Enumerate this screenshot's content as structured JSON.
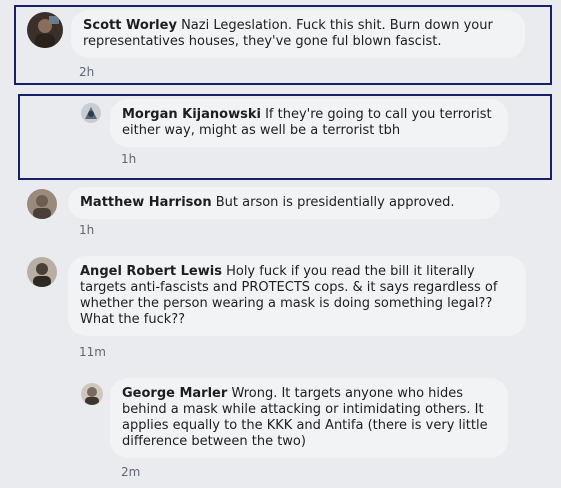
{
  "comments": [
    {
      "author": "Scott Worley",
      "text": "Nazi Legeslation. Fuck this shit. Burn down your representatives houses, they've gone ful blown fascist.",
      "time": "2h",
      "avatar_color": "#3b2f2a",
      "highlighted": true
    },
    {
      "author": "Morgan Kijanowski",
      "text": "If they're going to call you terrorist either way, might as well be a terrorist tbh",
      "time": "1h",
      "avatar_color": "#5a6a7a",
      "highlighted": true
    },
    {
      "author": "Matthew Harrison",
      "text": "But arson is presidentially approved.",
      "time": "1h",
      "avatar_color": "#6b5d52",
      "highlighted": false
    },
    {
      "author": "Angel Robert Lewis",
      "text": "Holy fuck if you read the bill it literally targets anti-fascists and PROTECTS cops. & it says regardless of whether the person wearing a mask is doing something legal?? What the fuck??",
      "time": "11m",
      "avatar_color": "#4a4038",
      "highlighted": false
    },
    {
      "author": "George Marler",
      "text": "Wrong. It targets anyone who hides behind a mask while attacking or intimidating others. It applies equally to the KKK and Antifa (there is very little difference between the two)",
      "time": "2m",
      "avatar_color": "#7a6a5e",
      "highlighted": false
    }
  ],
  "colors": {
    "background": "#e9ebee",
    "bubble": "#f2f3f5",
    "highlight_border": "#1a1f66",
    "timestamp": "#606770"
  }
}
